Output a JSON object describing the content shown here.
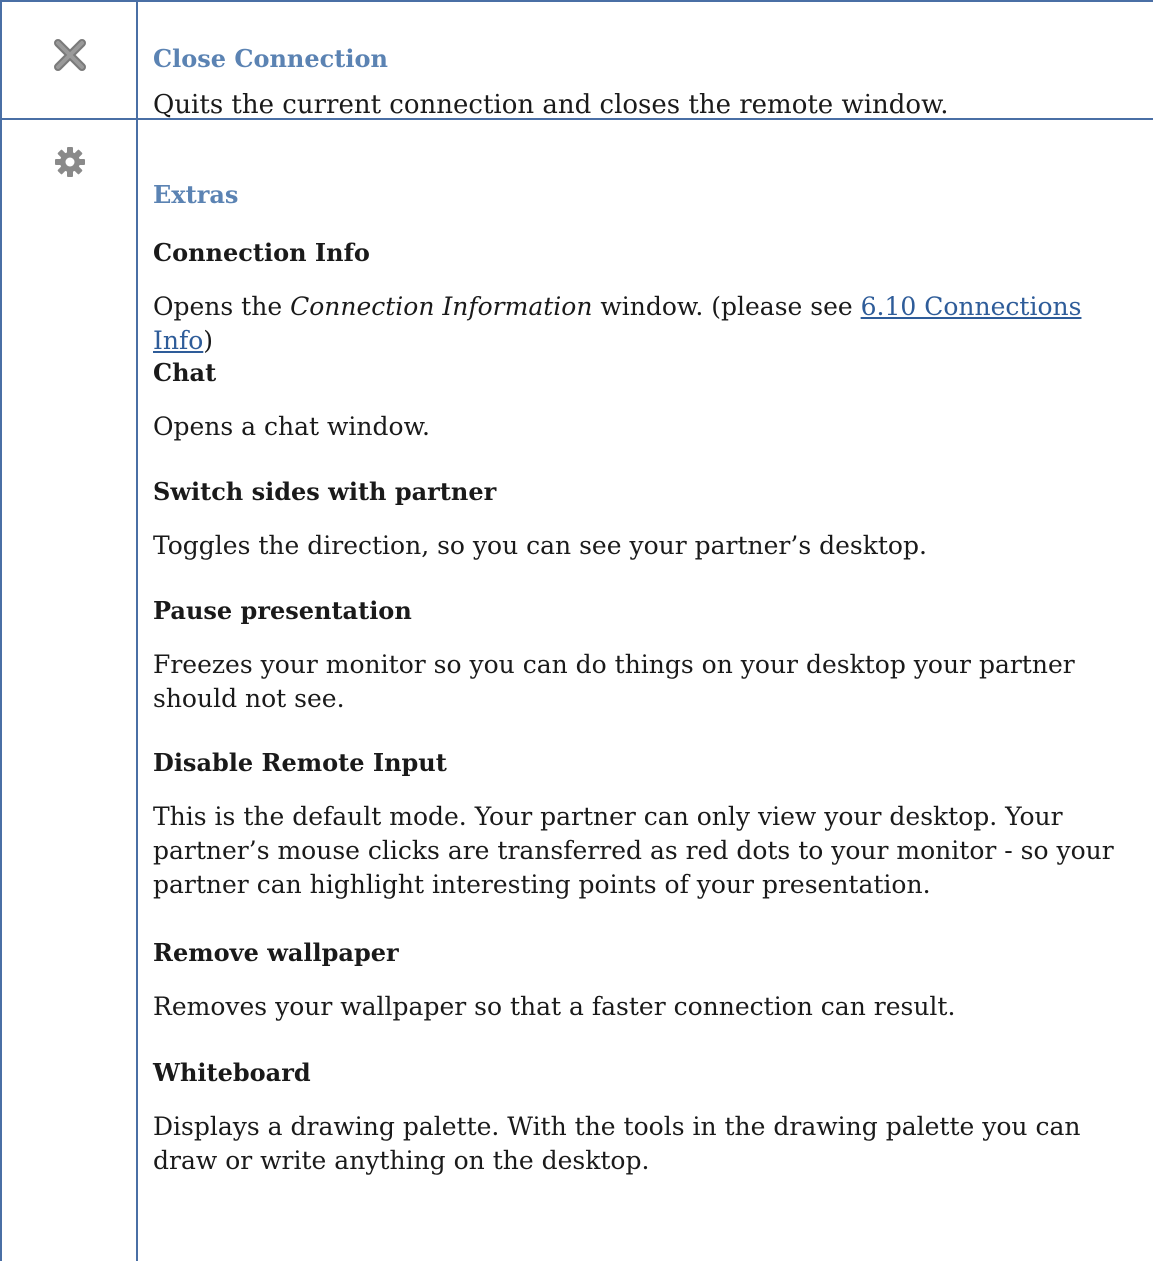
{
  "close": {
    "title": "Close Connection",
    "description": "Quits the current connection and closes the remote window.",
    "icon": "close-x-icon"
  },
  "extras": {
    "title": "Extras",
    "icon": "gear-icon",
    "items": [
      {
        "title": "Connection Info",
        "desc_before": "Opens the ",
        "desc_italic": "Connection Information",
        "desc_middle": " window. (please see ",
        "desc_link": "6.10 Connections Info",
        "desc_after": ")"
      },
      {
        "title": "Chat",
        "desc": "Opens a chat window."
      },
      {
        "title": "Switch sides with partner",
        "desc": "Toggles the direction, so you can see your partner’s desktop."
      },
      {
        "title": "Pause presentation",
        "desc": "Freezes your monitor so you can do things on your desktop your partner should not see."
      },
      {
        "title": "Disable Remote Input",
        "desc": "This is the default mode. Your partner can only view your desktop. Your partner’s mouse clicks are transferred as red dots to your monitor - so your partner can highlight interesting points of your presentation."
      },
      {
        "title": "Remove wallpaper",
        "desc": "Removes your wallpaper so that a faster connection can result."
      },
      {
        "title": "Whiteboard",
        "desc": "Displays a drawing palette. With the tools in the drawing palette you can draw or write anything on the desktop."
      }
    ]
  },
  "colors": {
    "border": "#4a6fa5",
    "heading": "#5b83b3",
    "link": "#2e5c99"
  }
}
